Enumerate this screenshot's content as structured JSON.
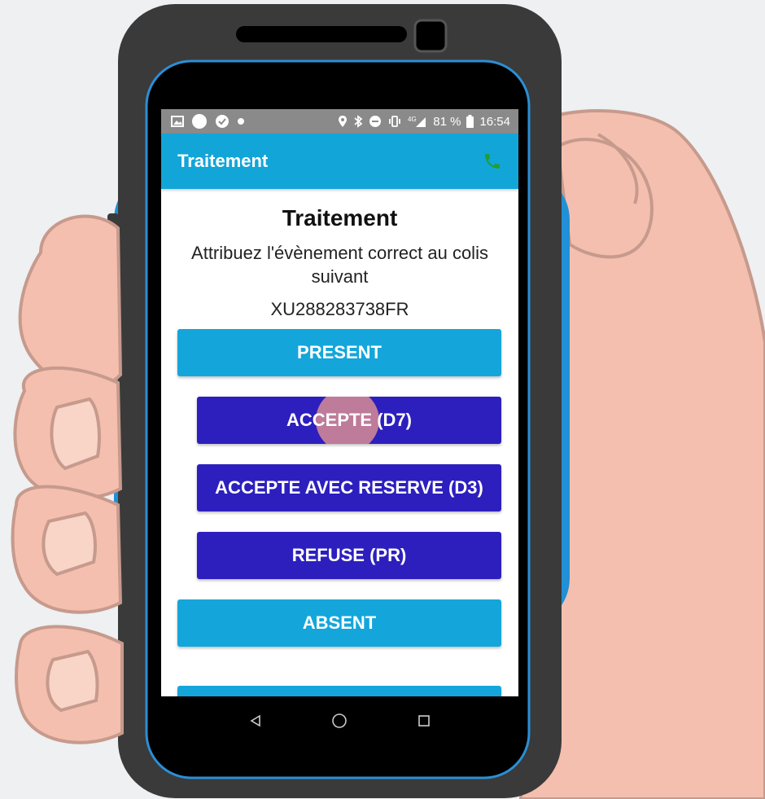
{
  "status_bar": {
    "battery_percent": "81 %",
    "time": "16:54",
    "network_label": "4G"
  },
  "app_bar": {
    "title": "Traitement",
    "phone_icon": "phone-icon"
  },
  "main": {
    "heading": "Traitement",
    "instruction": "Attribuez l'évènement correct au colis suivant",
    "tracking_number": "XU288283738FR",
    "buttons": [
      {
        "label": "PRESENT",
        "style": "light"
      },
      {
        "label": "ACCEPTE (D7)",
        "style": "dark",
        "pressed": true
      },
      {
        "label": "ACCEPTE AVEC RESERVE (D3)",
        "style": "dark"
      },
      {
        "label": "REFUSE (PR)",
        "style": "dark"
      },
      {
        "label": "ABSENT",
        "style": "light"
      }
    ]
  },
  "nav_bar": {
    "icons": [
      "back-icon",
      "home-icon",
      "recents-icon"
    ]
  },
  "colors": {
    "app_bar": "#12a5d8",
    "primary_light_button": "#14a6da",
    "primary_dark_button": "#2d1fbe",
    "status_bar": "#8a8a8a",
    "phone_icon": "#1e9e3a",
    "touch_ripple": "#f7a08c",
    "skin": "#f4bfae",
    "device_frame": "#3a3a3a",
    "device_bumper": "#2190d6"
  }
}
